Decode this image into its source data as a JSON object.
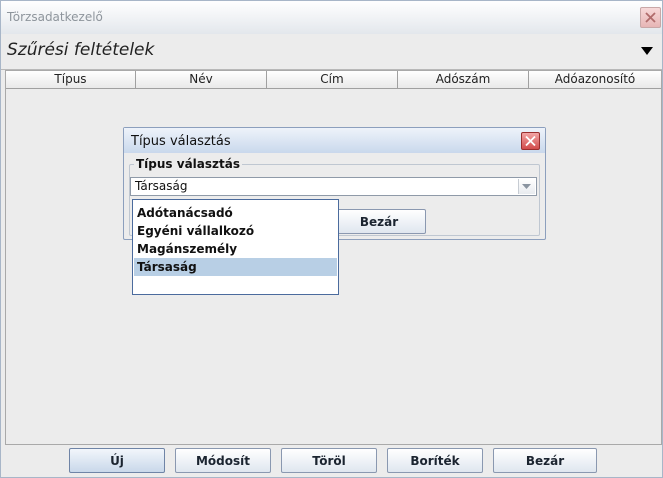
{
  "window": {
    "title": "Törzsadatkezelő",
    "close_icon": "close-icon"
  },
  "filter": {
    "title": "Szűrési feltételek",
    "toggle_icon": "triangle-down-icon"
  },
  "table": {
    "columns": [
      "Típus",
      "Név",
      "Cím",
      "Adószám",
      "Adóazonosító"
    ]
  },
  "buttons": {
    "new": "Új",
    "edit": "Módosít",
    "delete": "Töröl",
    "envelope": "Boríték",
    "close": "Bezár"
  },
  "dialog": {
    "title": "Típus választás",
    "group_label": "Típus választás",
    "combo_value": "Társaság",
    "close_button": "Bezár",
    "options": [
      "Adótanácsadó",
      "Egyéni vállalkozó",
      "Magánszemély",
      "Társaság"
    ],
    "selected_index": 3
  },
  "colors": {
    "selection": "#b8cfe5",
    "dialog_close": "#d24c4c"
  }
}
